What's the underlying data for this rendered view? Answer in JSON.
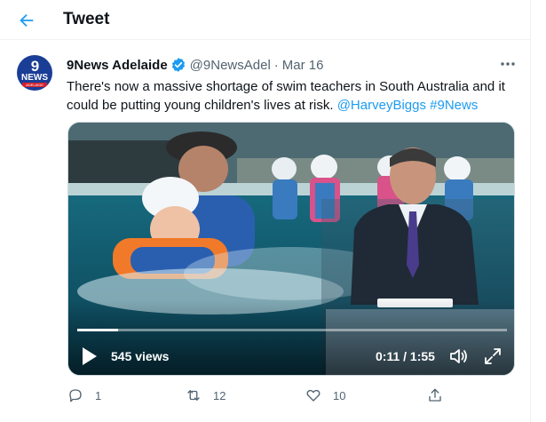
{
  "header": {
    "title": "Tweet",
    "back_icon": "arrow-left-icon"
  },
  "tweet": {
    "avatar": {
      "logo_number": "9",
      "logo_word": "NEWS",
      "logo_city": "ADELAIDE"
    },
    "display_name": "9News Adelaide",
    "handle": "@9NewsAdel",
    "separator": "·",
    "date": "Mar 16",
    "more_icon": "ellipsis-icon",
    "text": "There's now a massive shortage of swim teachers in South Australia and it could be putting young children's lives at risk.",
    "mention": "@HarveyBiggs",
    "hashtag": "#9News",
    "video": {
      "views": "545 views",
      "time": "0:11 / 1:55",
      "progress": 0.096,
      "play_icon": "play-icon",
      "volume_icon": "volume-icon",
      "fullscreen_icon": "fullscreen-icon"
    },
    "actions": {
      "reply_count": "1",
      "retweet_count": "12",
      "like_count": "10"
    }
  },
  "colors": {
    "accent": "#1d9bf0",
    "text_primary": "#0f1419",
    "text_secondary": "#536471"
  }
}
